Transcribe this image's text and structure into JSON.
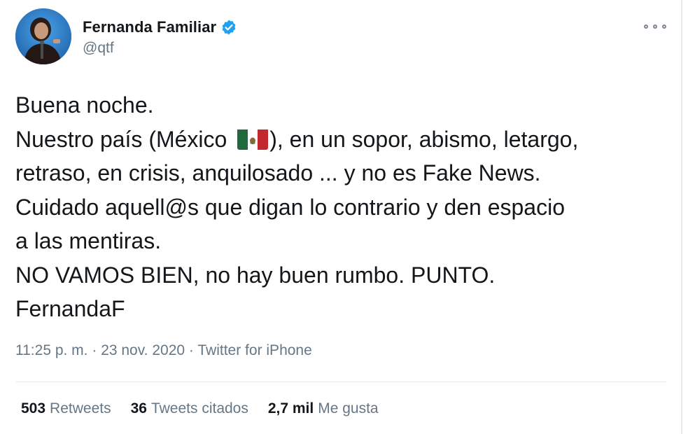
{
  "author": {
    "display_name": "Fernanda Familiar",
    "handle": "@qtf",
    "verified": true
  },
  "tweet": {
    "lines": {
      "l1": "Buena noche.",
      "l2a": "Nuestro país (México ",
      "l2b": "), en un sopor, abismo, letargo,",
      "l3": "retraso, en crisis, anquilosado ... y no es Fake News.",
      "l4": "Cuidado aquell@s que digan lo contrario y den espacio",
      "l5": "a las mentiras.",
      "l6": "NO VAMOS BIEN, no hay buen rumbo. PUNTO.",
      "l7": "FernandaF"
    },
    "emoji": "mexico-flag"
  },
  "meta": {
    "time": "11:25 p. m.",
    "separator": " · ",
    "date": "23 nov. 2020",
    "source": "Twitter for iPhone"
  },
  "stats": {
    "retweets_count": "503",
    "retweets_label": "Retweets",
    "quotes_count": "36",
    "quotes_label": "Tweets citados",
    "likes_count": "2,7 mil",
    "likes_label": "Me gusta"
  },
  "colors": {
    "text": "#14171a",
    "secondary": "#657786",
    "verified": "#1da1f2",
    "divider": "#e6ecf0"
  },
  "icons": {
    "verified": "verified-badge-icon",
    "more": "more-options-icon"
  }
}
